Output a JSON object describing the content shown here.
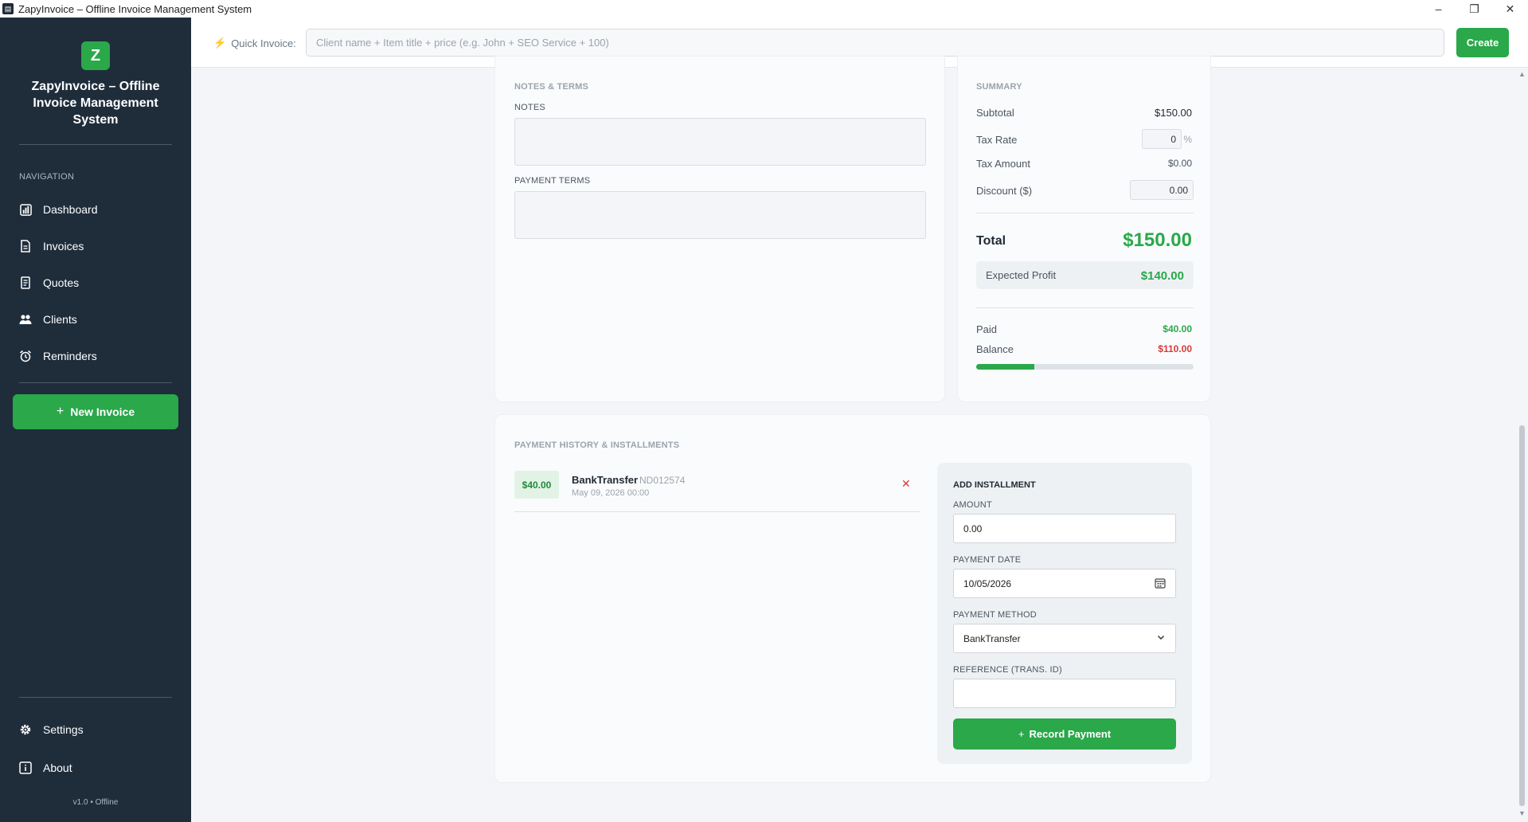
{
  "window": {
    "title": "ZapyInvoice – Offline Invoice Management System",
    "app_icon": "invoice-icon",
    "minimize": "–",
    "maximize": "❐",
    "close": "✕"
  },
  "sidebar": {
    "logo_letter": "Z",
    "app_name": "ZapyInvoice – Offline Invoice Management System",
    "nav_heading": "NAVIGATION",
    "items": [
      {
        "label": "Dashboard",
        "icon": "chart-icon"
      },
      {
        "label": "Invoices",
        "icon": "document-icon"
      },
      {
        "label": "Quotes",
        "icon": "quote-icon"
      },
      {
        "label": "Clients",
        "icon": "users-icon"
      },
      {
        "label": "Reminders",
        "icon": "alarm-icon"
      }
    ],
    "new_invoice_label": "New Invoice",
    "bottom_items": [
      {
        "label": "Settings",
        "icon": "gear-icon"
      },
      {
        "label": "About",
        "icon": "info-icon"
      }
    ],
    "version": "v1.0 • Offline"
  },
  "quickbar": {
    "label": "Quick Invoice:",
    "placeholder": "Client name + Item title + price (e.g. John + SEO Service + 100)",
    "create_label": "Create"
  },
  "notes_card": {
    "title": "NOTES & TERMS",
    "notes_label": "NOTES",
    "notes_value": "",
    "terms_label": "PAYMENT TERMS",
    "terms_value": ""
  },
  "summary": {
    "title": "SUMMARY",
    "subtotal_label": "Subtotal",
    "subtotal": "$150.00",
    "tax_rate_label": "Tax Rate",
    "tax_rate": "0",
    "tax_rate_unit": "%",
    "tax_amount_label": "Tax Amount",
    "tax_amount": "$0.00",
    "discount_label": "Discount ($)",
    "discount": "0.00",
    "total_label": "Total",
    "total": "$150.00",
    "profit_label": "Expected Profit",
    "profit": "$140.00",
    "paid_label": "Paid",
    "paid": "$40.00",
    "balance_label": "Balance",
    "balance": "$110.00",
    "paid_fraction": 0.2667,
    "colors": {
      "green": "#2aa84a",
      "red": "#d93a3a"
    }
  },
  "payments": {
    "title": "PAYMENT HISTORY & INSTALLMENTS",
    "history": [
      {
        "amount": "$40.00",
        "method": "BankTransfer",
        "reference": "ND012574",
        "date": "May 09, 2026 00:00"
      }
    ],
    "add": {
      "title": "ADD INSTALLMENT",
      "amount_label": "AMOUNT",
      "amount": "0.00",
      "date_label": "PAYMENT DATE",
      "date": "10/05/2026",
      "method_label": "PAYMENT METHOD",
      "method": "BankTransfer",
      "reference_label": "REFERENCE (TRANS. ID)",
      "reference": "",
      "record_label": "Record Payment"
    }
  }
}
